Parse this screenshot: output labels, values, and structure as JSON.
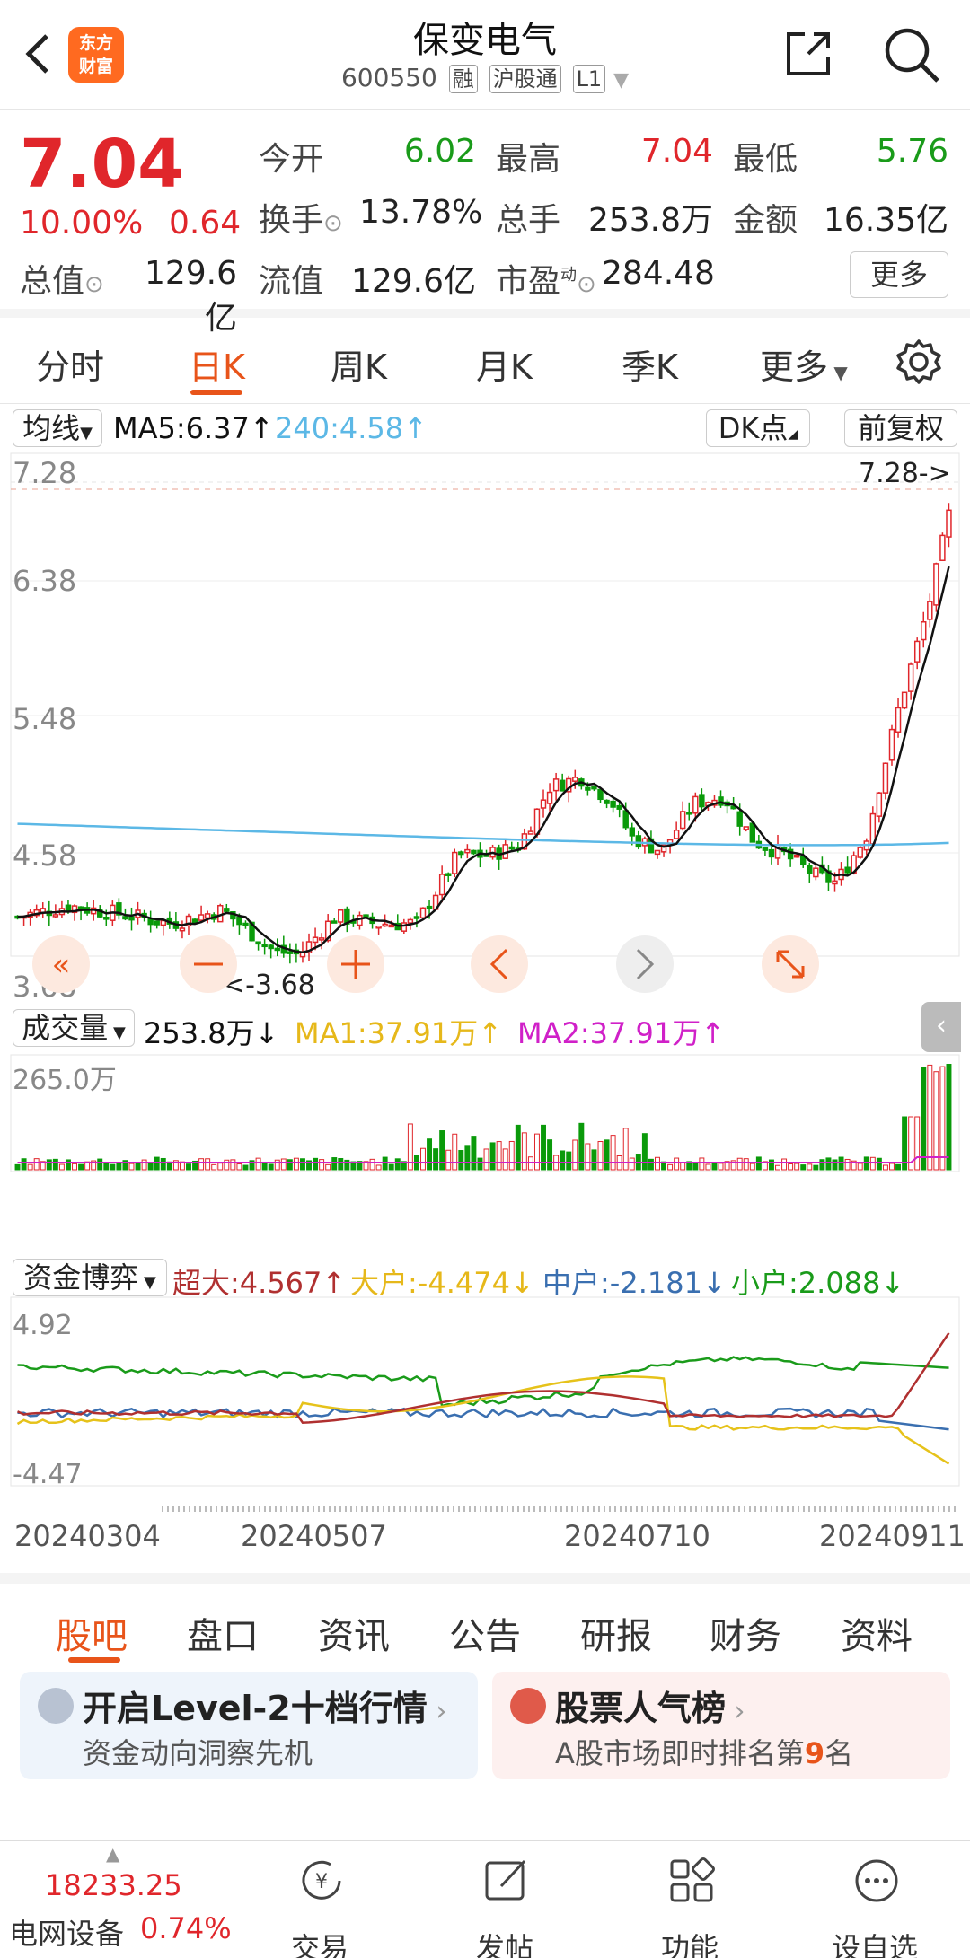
{
  "header": {
    "title": "保变电气",
    "code": "600550",
    "tags": [
      "融",
      "沪股通",
      "L1"
    ],
    "logo_text_1": "东方",
    "logo_text_2": "财富"
  },
  "quote": {
    "price": "7.04",
    "change_pct": "10.00%",
    "change": "0.64",
    "rows": [
      [
        {
          "label": "今开",
          "value": "6.02"
        },
        {
          "label": "最高",
          "value": "7.04"
        },
        {
          "label": "最低",
          "value": "5.76"
        }
      ],
      [
        {
          "label": "换手",
          "value": "13.78%"
        },
        {
          "label": "总手",
          "value": "253.8万"
        },
        {
          "label": "金额",
          "value": "16.35亿"
        }
      ],
      [
        {
          "label": "总值",
          "value": "129.6亿"
        },
        {
          "label": "流值",
          "value": "129.6亿"
        },
        {
          "label": "市盈",
          "sup": "动",
          "value": "284.48"
        }
      ]
    ],
    "more_label": "更多"
  },
  "ktabs": [
    "分时",
    "日K",
    "周K",
    "月K",
    "季K",
    "更多"
  ],
  "chart": {
    "ma_selector": "均线",
    "ma5": "MA5:6.37",
    "ma240": "240:4.58",
    "dk_label": "DK点",
    "adjust_label": "前复权",
    "y_ticks": [
      "7.28",
      "6.38",
      "5.48",
      "4.58",
      "3.68"
    ],
    "high_marker": "7.28->",
    "low_marker": "<-3.68",
    "vol_selector": "成交量",
    "vol_value": "253.8万",
    "vol_ma1": "MA1:37.91万",
    "vol_ma2": "MA2:37.91万",
    "vol_top": "265.0万",
    "fund_selector": "资金博弈",
    "fund_super": "超大:4.567",
    "fund_big": "大户:-4.474",
    "fund_mid": "中户:-2.181",
    "fund_small": "小户:2.088",
    "fund_top": "4.92",
    "fund_bottom": "-4.47",
    "x_dates": [
      "20240304",
      "20240507",
      "20240710",
      "20240911"
    ],
    "colors": {
      "up": "#e0262b",
      "down": "#0a9a0a",
      "ma5": "#111111",
      "ma240": "#5cb8e6",
      "super": "#b03030",
      "big": "#e6c21a",
      "mid": "#3a6fb0",
      "small": "#1a9b1a"
    }
  },
  "chart_data": {
    "type": "candlestick",
    "x_range": [
      "20240304",
      "20240911"
    ],
    "ylim": [
      3.68,
      7.28
    ],
    "latest": {
      "open": 6.02,
      "high": 7.04,
      "low": 5.76,
      "close": 7.04
    }
  },
  "btabs": [
    "股吧",
    "盘口",
    "资讯",
    "公告",
    "研报",
    "财务",
    "资料"
  ],
  "cards": [
    {
      "title": "开启Level-2十档行情",
      "sub": "资金动向洞察先机"
    },
    {
      "title": "股票人气榜",
      "sub_pre": "A股市场即时排名第",
      "sub_num": "9",
      "sub_post": "名"
    }
  ],
  "bottom_nav": {
    "index_value": "18233.25",
    "index_name": "电网设备",
    "index_pct": "0.74%",
    "items": [
      "交易",
      "发帖",
      "功能",
      "设自选"
    ]
  }
}
